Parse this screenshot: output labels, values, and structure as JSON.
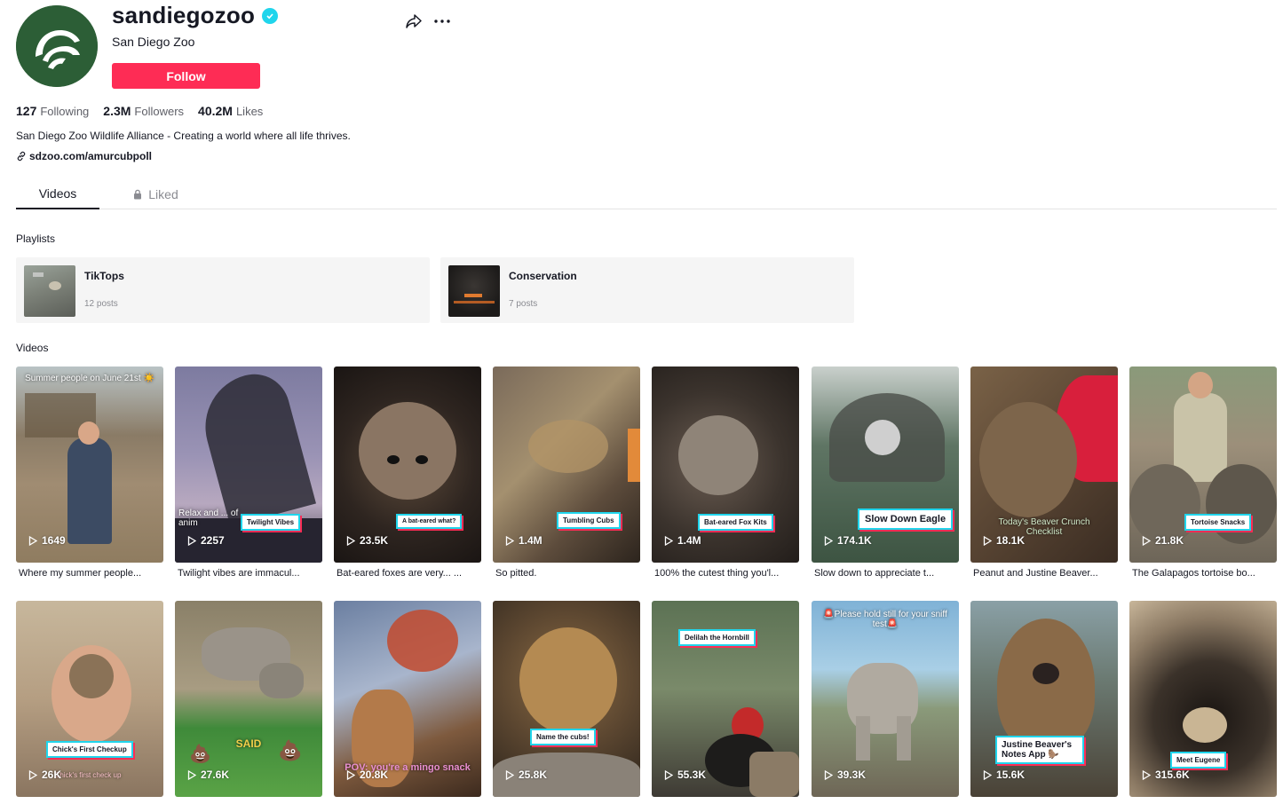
{
  "profile": {
    "username": "sandiegozoo",
    "display_name": "San Diego Zoo",
    "follow_label": "Follow",
    "stats": [
      {
        "value": "127",
        "label": "Following"
      },
      {
        "value": "2.3M",
        "label": "Followers"
      },
      {
        "value": "40.2M",
        "label": "Likes"
      }
    ],
    "bio": "San Diego Zoo Wildlife Alliance - Creating a world where all life thrives.",
    "link": "sdzoo.com/amurcubpoll"
  },
  "icons": {
    "share": "share-icon",
    "more": "more-icon",
    "verified": "verified-icon",
    "link": "link-icon",
    "lock": "lock-icon",
    "play": "play-icon"
  },
  "colors": {
    "accent": "#fe2c55",
    "verified": "#20d5ec",
    "logo": "#2c5e36"
  },
  "tabs": {
    "videos": "Videos",
    "liked": "Liked"
  },
  "sections": {
    "playlists": "Playlists",
    "videos": "Videos"
  },
  "playlists": [
    {
      "title": "TikTops",
      "count": "12 posts"
    },
    {
      "title": "Conservation",
      "count": "7 posts"
    }
  ],
  "videos": [
    {
      "views": "1649",
      "caption": "Where my summer people...",
      "overlay": "Summer people on June 21st ☀️"
    },
    {
      "views": "2257",
      "caption": "Twilight vibes are immacul...",
      "sticker": "Twilight Vibes",
      "overlay": "Relax and ... of anim"
    },
    {
      "views": "23.5K",
      "caption": "Bat-eared foxes are very... ...",
      "sticker": "A bat-eared what?"
    },
    {
      "views": "1.4M",
      "caption": "So pitted.",
      "sticker": "Tumbling Cubs"
    },
    {
      "views": "1.4M",
      "caption": "100% the cutest thing you'l...",
      "sticker": "Bat-eared Fox Kits"
    },
    {
      "views": "174.1K",
      "caption": "Slow down to appreciate t...",
      "sticker": "Slow Down Eagle"
    },
    {
      "views": "18.1K",
      "caption": "Peanut and Justine Beaver...",
      "overlay": "Today's Beaver Crunch Checklist"
    },
    {
      "views": "21.8K",
      "caption": "The Galapagos tortoise bo...",
      "sticker": "Tortoise Snacks"
    },
    {
      "views": "26K",
      "caption": "",
      "sticker": "Chick's First Checkup",
      "overlay": "Chick's first check up"
    },
    {
      "views": "27.6K",
      "caption": "",
      "overlay": "SAID"
    },
    {
      "views": "20.8K",
      "caption": "",
      "overlay": "POV: you're a mingo snack"
    },
    {
      "views": "25.8K",
      "caption": "",
      "sticker": "Name the cubs!"
    },
    {
      "views": "55.3K",
      "caption": "",
      "sticker": "Delilah the Hornbill"
    },
    {
      "views": "39.3K",
      "caption": "",
      "overlay": "🚨Please hold still for your sniff test🚨"
    },
    {
      "views": "15.6K",
      "caption": "",
      "sticker": "Justine Beaver's Notes App 🦫"
    },
    {
      "views": "315.6K",
      "caption": "",
      "sticker": "Meet Eugene"
    }
  ]
}
